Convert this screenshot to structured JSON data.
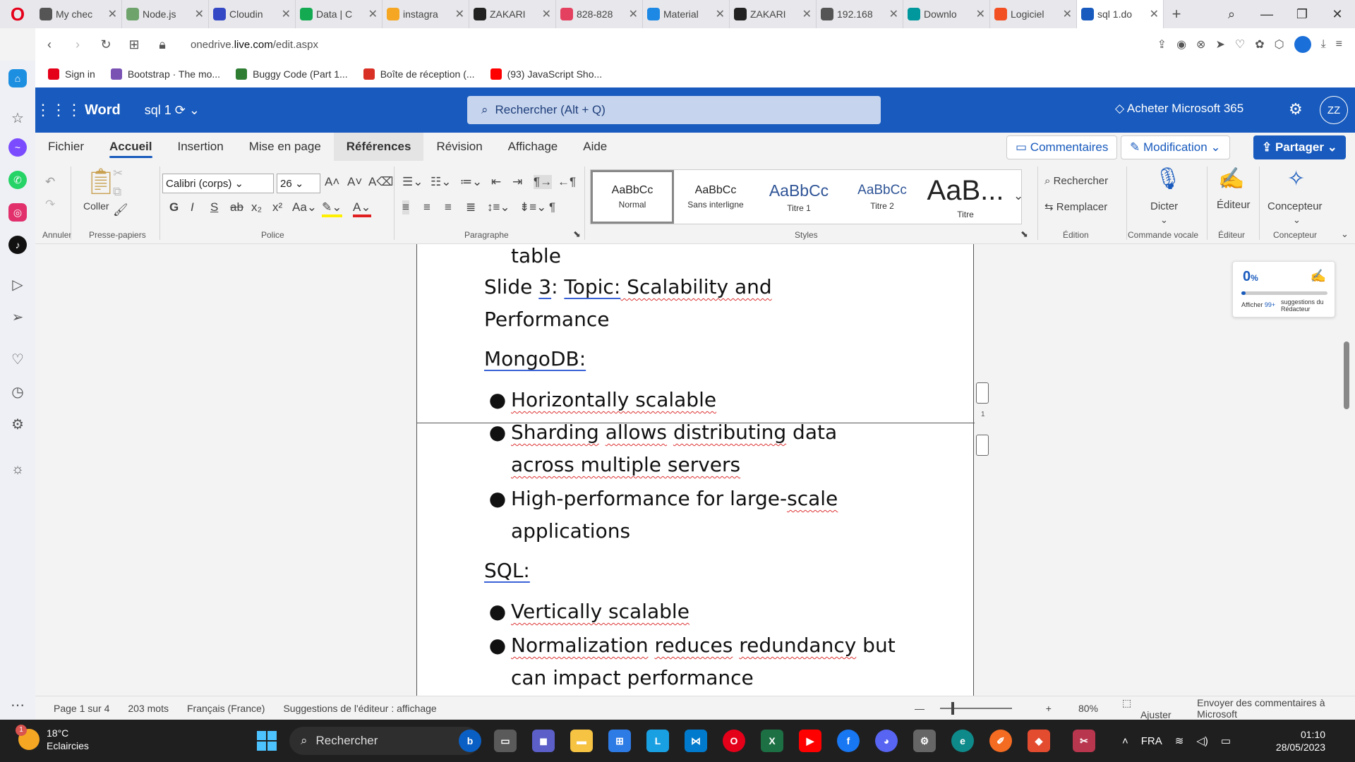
{
  "browser": {
    "tabs": [
      {
        "label": "My chec",
        "color": "#555555"
      },
      {
        "label": "Node.js",
        "color": "#6fa36c"
      },
      {
        "label": "Cloudin",
        "color": "#3448c5"
      },
      {
        "label": "Data | C",
        "color": "#13aa52"
      },
      {
        "label": "instagra",
        "color": "#f5a623"
      },
      {
        "label": "ZAKARI",
        "color": "#222222"
      },
      {
        "label": "828-828",
        "color": "#e4405f"
      },
      {
        "label": "Material",
        "color": "#1e88e5"
      },
      {
        "label": "ZAKARI",
        "color": "#222222"
      },
      {
        "label": "192.168",
        "color": "#555555"
      },
      {
        "label": "Downlo",
        "color": "#00979d"
      },
      {
        "label": "Logiciel",
        "color": "#f25022"
      },
      {
        "label": "sql 1.do",
        "color": "#185abd"
      }
    ],
    "url_prefix": "onedrive.",
    "url_domain": "live.com",
    "url_path": "/edit.aspx",
    "bookmarks": [
      {
        "label": "Sign in",
        "color": "#e5001a"
      },
      {
        "label": "Bootstrap · The mo...",
        "color": "#7952b3"
      },
      {
        "label": "Buggy Code (Part 1...",
        "color": "#2e7d32"
      },
      {
        "label": "Boîte de réception (...",
        "color": "#d93025"
      },
      {
        "label": "(93) JavaScript Sho...",
        "color": "#ff0000"
      }
    ]
  },
  "word": {
    "app_name": "Word",
    "doc_name": "sql 1",
    "search_placeholder": "Rechercher (Alt + Q)",
    "buy": "Acheter Microsoft 365",
    "avatar": "ZZ",
    "tabs": [
      "Fichier",
      "Accueil",
      "Insertion",
      "Mise en page",
      "Références",
      "Révision",
      "Affichage",
      "Aide"
    ],
    "comments": "Commentaires",
    "modification": "Modification",
    "share": "Partager",
    "ribbon": {
      "undo_group": "Annuler",
      "paste": "Coller",
      "clipboard_group": "Presse-papiers",
      "font_name": "Calibri (corps)",
      "font_size": "26",
      "font_group": "Police",
      "para_group": "Paragraphe",
      "styles_group": "Styles",
      "styles": [
        {
          "preview": "AaBbCc",
          "name": "Normal"
        },
        {
          "preview": "AaBbCc",
          "name": "Sans interligne"
        },
        {
          "preview": "AaBbCc",
          "name": "Titre 1"
        },
        {
          "preview": "AaBbCc",
          "name": "Titre 2"
        },
        {
          "preview": "AaB...",
          "name": "Titre"
        }
      ],
      "find": "Rechercher",
      "replace": "Remplacer",
      "edit_group": "Édition",
      "dictate": "Dicter",
      "voice_group": "Commande vocale",
      "editor": "Éditeur",
      "editor_group": "Éditeur",
      "designer": "Concepteur",
      "designer_group": "Concepteur"
    }
  },
  "document": {
    "line_table": "table",
    "slide_prefix": "Slide ",
    "slide_num": "3",
    "slide_colon": ": ",
    "slide_topic": "Topic:",
    "slide_rest": " Scalability and",
    "performance": "Performance",
    "mongodb_heading": "MongoDB:",
    "bullet1": "Horizontally scalable",
    "b2_w1": "Sharding",
    "b2_w2": "allows",
    "b2_w3": "distributing",
    "b2_rest": " data",
    "b2_line2": "across multiple servers",
    "b3_a": "High-performance for large-",
    "b3_b": "scale",
    "b3_line2": "applications",
    "sql_heading": "SQL:",
    "bullet4": "Vertically scalable",
    "b5_w1": "Normalization",
    "b5_w2": "reduces",
    "b5_w3": "redundancy",
    "b5_rest": " but",
    "b5_line2": "can impact performance",
    "page_number": "1"
  },
  "editor_card": {
    "score": "0",
    "score_unit": "%",
    "progress": 0.0,
    "show": "Afficher",
    "count": "99+",
    "suggestions": "suggestions du Rédacteur"
  },
  "status": {
    "page": "Page 1 sur 4",
    "words": "203 mots",
    "language": "Français (France)",
    "editor_suggestions": "Suggestions de l'éditeur : affichage",
    "zoom": "80%",
    "fit": "Ajuster",
    "feedback": "Envoyer des commentaires à Microsoft"
  },
  "taskbar": {
    "temperature": "18°C",
    "weather": "Eclaircies",
    "notif": "1",
    "search": "Rechercher",
    "lang": "FRA",
    "time": "01:10",
    "date": "28/05/2023"
  }
}
